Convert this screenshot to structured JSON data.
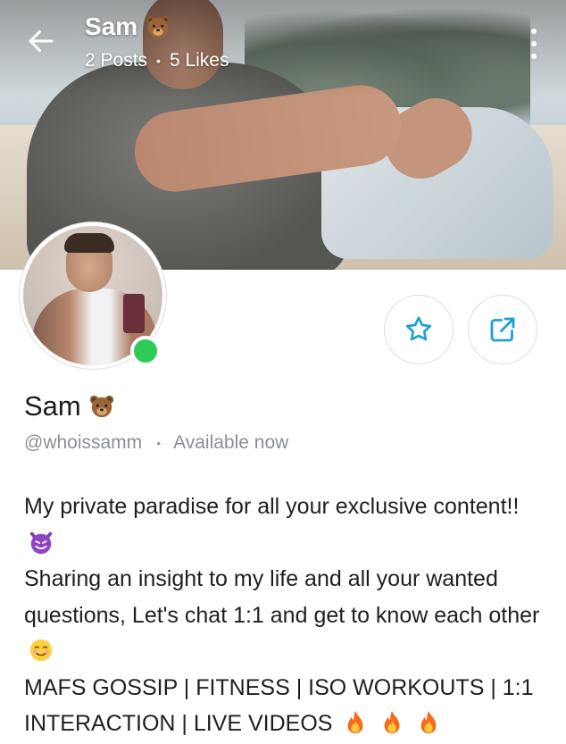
{
  "header": {
    "name": "Sam",
    "posts": "2 Posts",
    "likes": "5 Likes"
  },
  "icons": {
    "back": "arrow-left-icon",
    "more": "more-vertical-icon",
    "favorite": "star-icon",
    "share": "share-icon",
    "name_emoji": "bear-face-icon"
  },
  "profile": {
    "name": "Sam",
    "handle": "@whoissamm",
    "status": "Available now"
  },
  "bio": {
    "line1": "My private paradise for all your exclusive content!!",
    "line2": "Sharing an insight to my life and all your wanted questions, Let's chat 1:1 and get to know each other",
    "line3": "MAFS GOSSIP | FITNESS | ISO WORKOUTS | 1:1 INTERACTION | LIVE VIDEOS"
  },
  "colors": {
    "accent": "#1ea1d9",
    "online": "#2ecc57",
    "muted": "#8a8f97"
  }
}
